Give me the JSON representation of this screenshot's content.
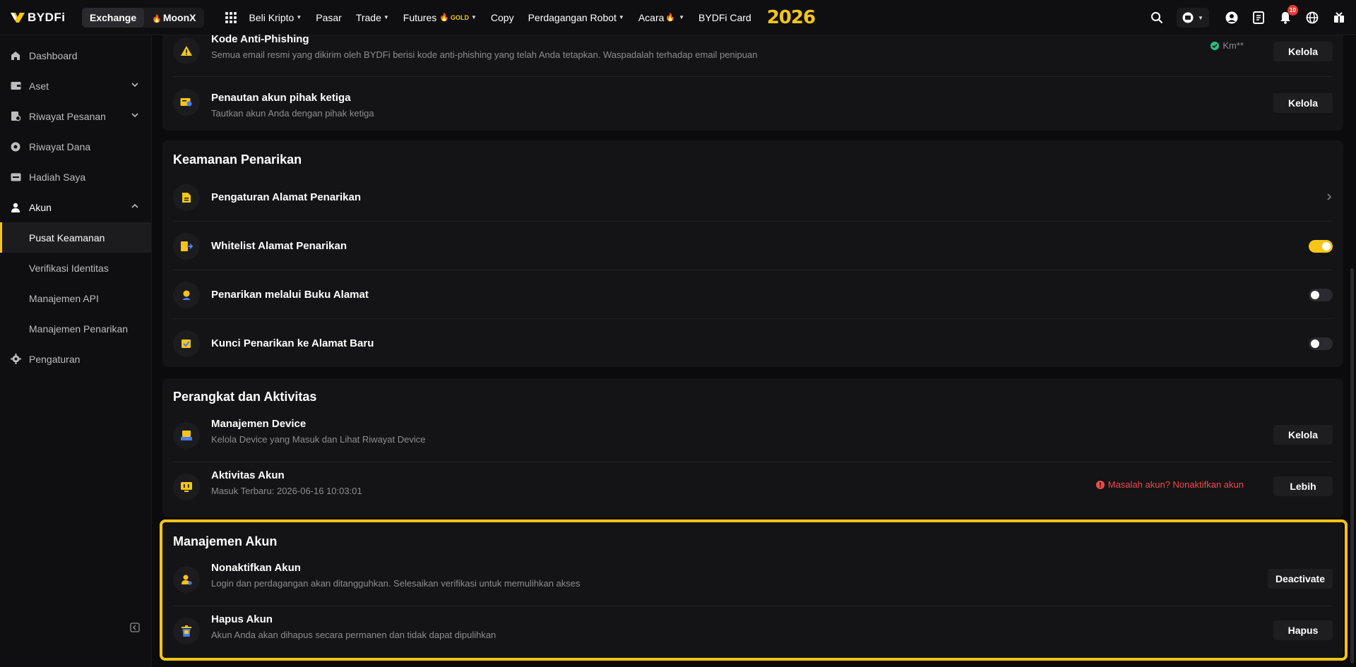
{
  "topnav": {
    "logo": "BYDFi",
    "segments": [
      {
        "label": "Exchange",
        "active": true
      },
      {
        "label": "MoonX",
        "active": false
      }
    ],
    "menu": [
      {
        "label": "Beli Kripto",
        "caret": true
      },
      {
        "label": "Pasar",
        "caret": false
      },
      {
        "label": "Trade",
        "caret": true
      },
      {
        "label": "Futures",
        "badge": "GOLD",
        "caret": true
      },
      {
        "label": "Copy",
        "caret": false
      },
      {
        "label": "Perdagangan Robot",
        "caret": true
      },
      {
        "label": "Acara",
        "caret": true
      },
      {
        "label": "BYDFi Card",
        "caret": false
      }
    ],
    "year_badge": "2026",
    "notification_count": "10"
  },
  "sidebar": {
    "items": [
      {
        "label": "Dashboard",
        "icon": "home-icon"
      },
      {
        "label": "Aset",
        "icon": "wallet-icon"
      },
      {
        "label": "Riwayat Pesanan",
        "icon": "order-history-icon"
      },
      {
        "label": "Riwayat Dana",
        "icon": "fund-history-icon"
      },
      {
        "label": "Hadiah Saya",
        "icon": "gift-ticket-icon"
      },
      {
        "label": "Akun",
        "icon": "user-icon"
      },
      {
        "label": "Pengaturan",
        "icon": "gear-icon"
      }
    ],
    "sub_items": [
      {
        "label": "Pusat Keamanan",
        "active": true
      },
      {
        "label": "Verifikasi Identitas",
        "active": false
      },
      {
        "label": "Manajemen API",
        "active": false
      },
      {
        "label": "Manajemen Penarikan",
        "active": false
      }
    ]
  },
  "top_card": {
    "rows": [
      {
        "title": "Kode Anti-Phishing",
        "desc": "Semua email resmi yang dikirim oleh BYDFi berisi kode anti-phishing yang telah Anda tetapkan. Waspadalah terhadap email penipuan",
        "status": "Km**",
        "button": "Kelola"
      },
      {
        "title": "Penautan akun pihak ketiga",
        "desc": "Tautkan akun Anda dengan pihak ketiga",
        "button": "Kelola"
      }
    ]
  },
  "withdrawal_security": {
    "title": "Keamanan Penarikan",
    "rows": [
      {
        "title": "Pengaturan Alamat Penarikan"
      },
      {
        "title": "Whitelist Alamat Penarikan",
        "toggle": true
      },
      {
        "title": "Penarikan melalui Buku Alamat",
        "toggle": false
      },
      {
        "title": "Kunci Penarikan ke Alamat Baru",
        "toggle": false
      }
    ]
  },
  "devices": {
    "title": "Perangkat dan Aktivitas",
    "rows": [
      {
        "title": "Manajemen Device",
        "desc": "Kelola Device yang Masuk dan Lihat Riwayat Device",
        "button": "Kelola"
      },
      {
        "title": "Aktivitas Akun",
        "desc": "Masuk Terbaru: 2026-06-16 10:03:01",
        "warning": "Masalah akun? Nonaktifkan akun",
        "button": "Lebih"
      }
    ]
  },
  "account_management": {
    "title": "Manajemen Akun",
    "rows": [
      {
        "title": "Nonaktifkan Akun",
        "desc": "Login dan perdagangan akan ditangguhkan. Selesaikan verifikasi untuk memulihkan akses",
        "button": "Deactivate"
      },
      {
        "title": "Hapus Akun",
        "desc": "Akun Anda akan dihapus secara permanen dan tidak dapat dipulihkan",
        "button": "Hapus"
      }
    ]
  },
  "colors": {
    "accent": "#f5c518",
    "warning": "#f04848",
    "success": "#2ebd85"
  }
}
